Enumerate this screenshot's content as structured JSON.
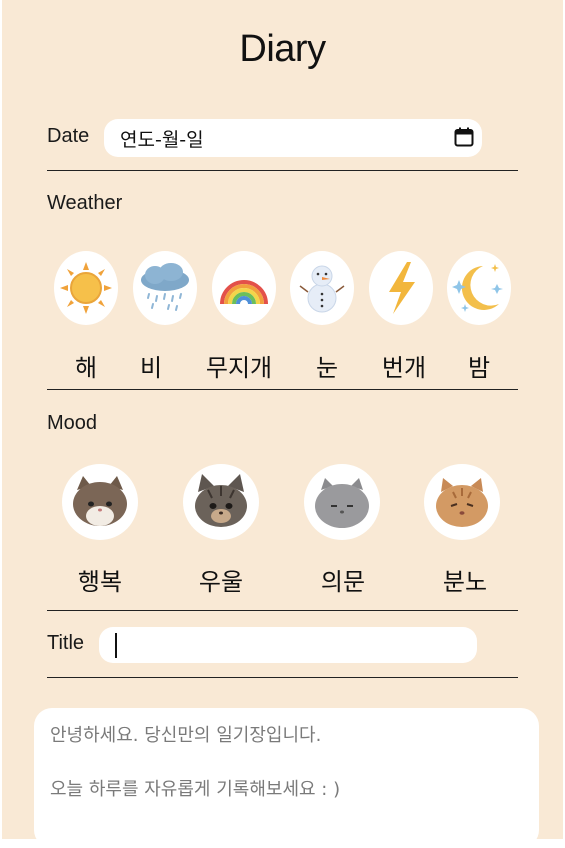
{
  "header": {
    "title": "Diary"
  },
  "date": {
    "label": "Date",
    "placeholder": "연도-월-일"
  },
  "weather": {
    "label": "Weather",
    "items": [
      {
        "name": "해",
        "icon": "sun-icon"
      },
      {
        "name": "비",
        "icon": "rain-cloud-icon"
      },
      {
        "name": "무지개",
        "icon": "rainbow-icon"
      },
      {
        "name": "눈",
        "icon": "snowman-icon"
      },
      {
        "name": "번개",
        "icon": "lightning-icon"
      },
      {
        "name": "밤",
        "icon": "moon-stars-icon"
      }
    ]
  },
  "mood": {
    "label": "Mood",
    "items": [
      {
        "name": "행복",
        "icon": "brown-cat-icon"
      },
      {
        "name": "우울",
        "icon": "tabby-cat-icon"
      },
      {
        "name": "의문",
        "icon": "gray-cat-icon"
      },
      {
        "name": "분노",
        "icon": "orange-cat-icon"
      }
    ]
  },
  "title_field": {
    "label": "Title",
    "value": ""
  },
  "content": {
    "line1": "안녕하세요. 당신만의 일기장입니다.",
    "line2": "오늘 하루를 자유롭게 기록해보세요 : )"
  },
  "colors": {
    "background": "#f9e9d5",
    "field": "#ffffff"
  }
}
